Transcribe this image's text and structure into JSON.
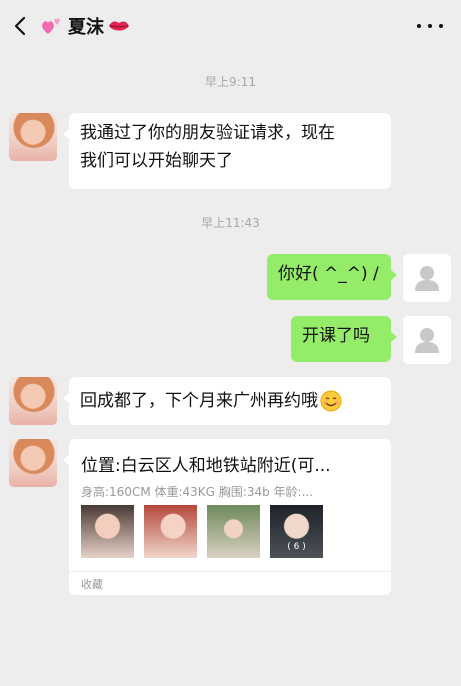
{
  "header": {
    "title": "夏沫",
    "left_icon": "hearts-icon",
    "right_icon": "lips-icon",
    "back_icon": "chevron-left-icon",
    "more_icon": "more-dots-icon"
  },
  "timestamps": [
    "早上9:11",
    "早上11:43"
  ],
  "messages": [
    {
      "side": "left",
      "lines": [
        "我通过了你的朋友验证请求，现在",
        "我们可以开始聊天了"
      ]
    },
    {
      "side": "right",
      "text": "你好( ^_^) /"
    },
    {
      "side": "right",
      "text": "开课了吗"
    },
    {
      "side": "left",
      "text": "回成都了，下个月来广州再约哦",
      "emoji": "smile-emoji"
    }
  ],
  "card": {
    "title": "位置:白云区人和地铁站附近(可...",
    "subtitle": "身高:160CM 体重:43KG 胸围:34b 年龄:...",
    "photo_count": "( 6 )",
    "footer": "收藏"
  },
  "colors": {
    "background": "#ededed",
    "right_bubble": "#95ec69",
    "left_bubble": "#ffffff"
  }
}
